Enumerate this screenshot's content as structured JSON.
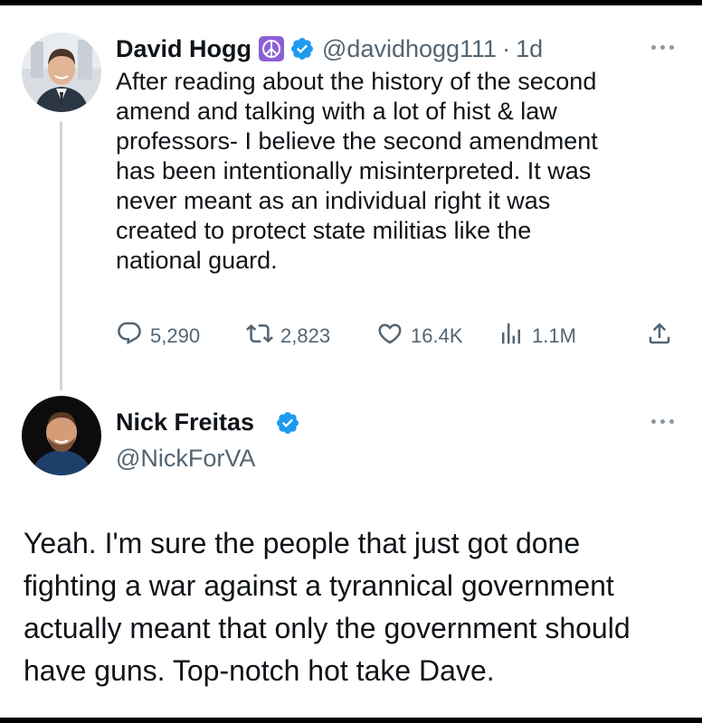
{
  "tweet1": {
    "name": "David Hogg",
    "handle": "@davidhogg111",
    "separator": "·",
    "time": "1d",
    "text": "After reading  about the history of the second\namend and talking with a lot of hist & law\nprofessors- I believe the second amendment\nhas been intentionally misinterpreted. It was\nnever meant as an individual right it was\ncreated to protect state militias like the\nnational guard.",
    "stats": {
      "replies": "5,290",
      "reposts": "2,823",
      "likes": "16.4K",
      "views": "1.1M"
    },
    "icons": [
      "peace-icon",
      "verified-icon",
      "more-icon",
      "reply-icon",
      "repost-icon",
      "like-icon",
      "views-icon",
      "share-icon"
    ]
  },
  "tweet2": {
    "name": "Nick Freitas",
    "handle": "@NickForVA",
    "text": "Yeah. I'm sure the people that just got done\nfighting a war against a tyrannical government\nactually meant that only the government should\nhave guns. Top-notch hot take Dave.",
    "icons": [
      "verified-icon",
      "more-icon"
    ]
  },
  "colors": {
    "verified": "#1d9bf0",
    "peace_bg": "#8b5fd6",
    "secondary_text": "#536471",
    "thread_line": "#cfd9de"
  }
}
